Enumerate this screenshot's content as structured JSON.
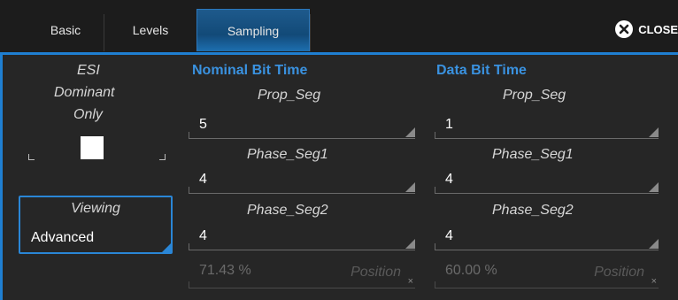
{
  "tabs": [
    {
      "label": "Basic"
    },
    {
      "label": "Levels"
    },
    {
      "label": "Sampling"
    }
  ],
  "close_label": "CLOSE",
  "esi": {
    "line1": "ESI",
    "line2": "Dominant",
    "line3": "Only"
  },
  "viewing": {
    "title": "Viewing",
    "value": "Advanced"
  },
  "nominal": {
    "header": "Nominal Bit Time",
    "prop_label": "Prop_Seg",
    "prop_value": "5",
    "phase1_label": "Phase_Seg1",
    "phase1_value": "4",
    "phase2_label": "Phase_Seg2",
    "phase2_value": "4",
    "position_value": "71.43 %",
    "position_label": "Position"
  },
  "data": {
    "header": "Data Bit Time",
    "prop_label": "Prop_Seg",
    "prop_value": "1",
    "phase1_label": "Phase_Seg1",
    "phase1_value": "4",
    "phase2_label": "Phase_Seg2",
    "phase2_value": "4",
    "position_value": "60.00 %",
    "position_label": "Position"
  },
  "colors": {
    "accent": "#1f7fd1",
    "header": "#3a92e0",
    "panel": "#262626"
  }
}
